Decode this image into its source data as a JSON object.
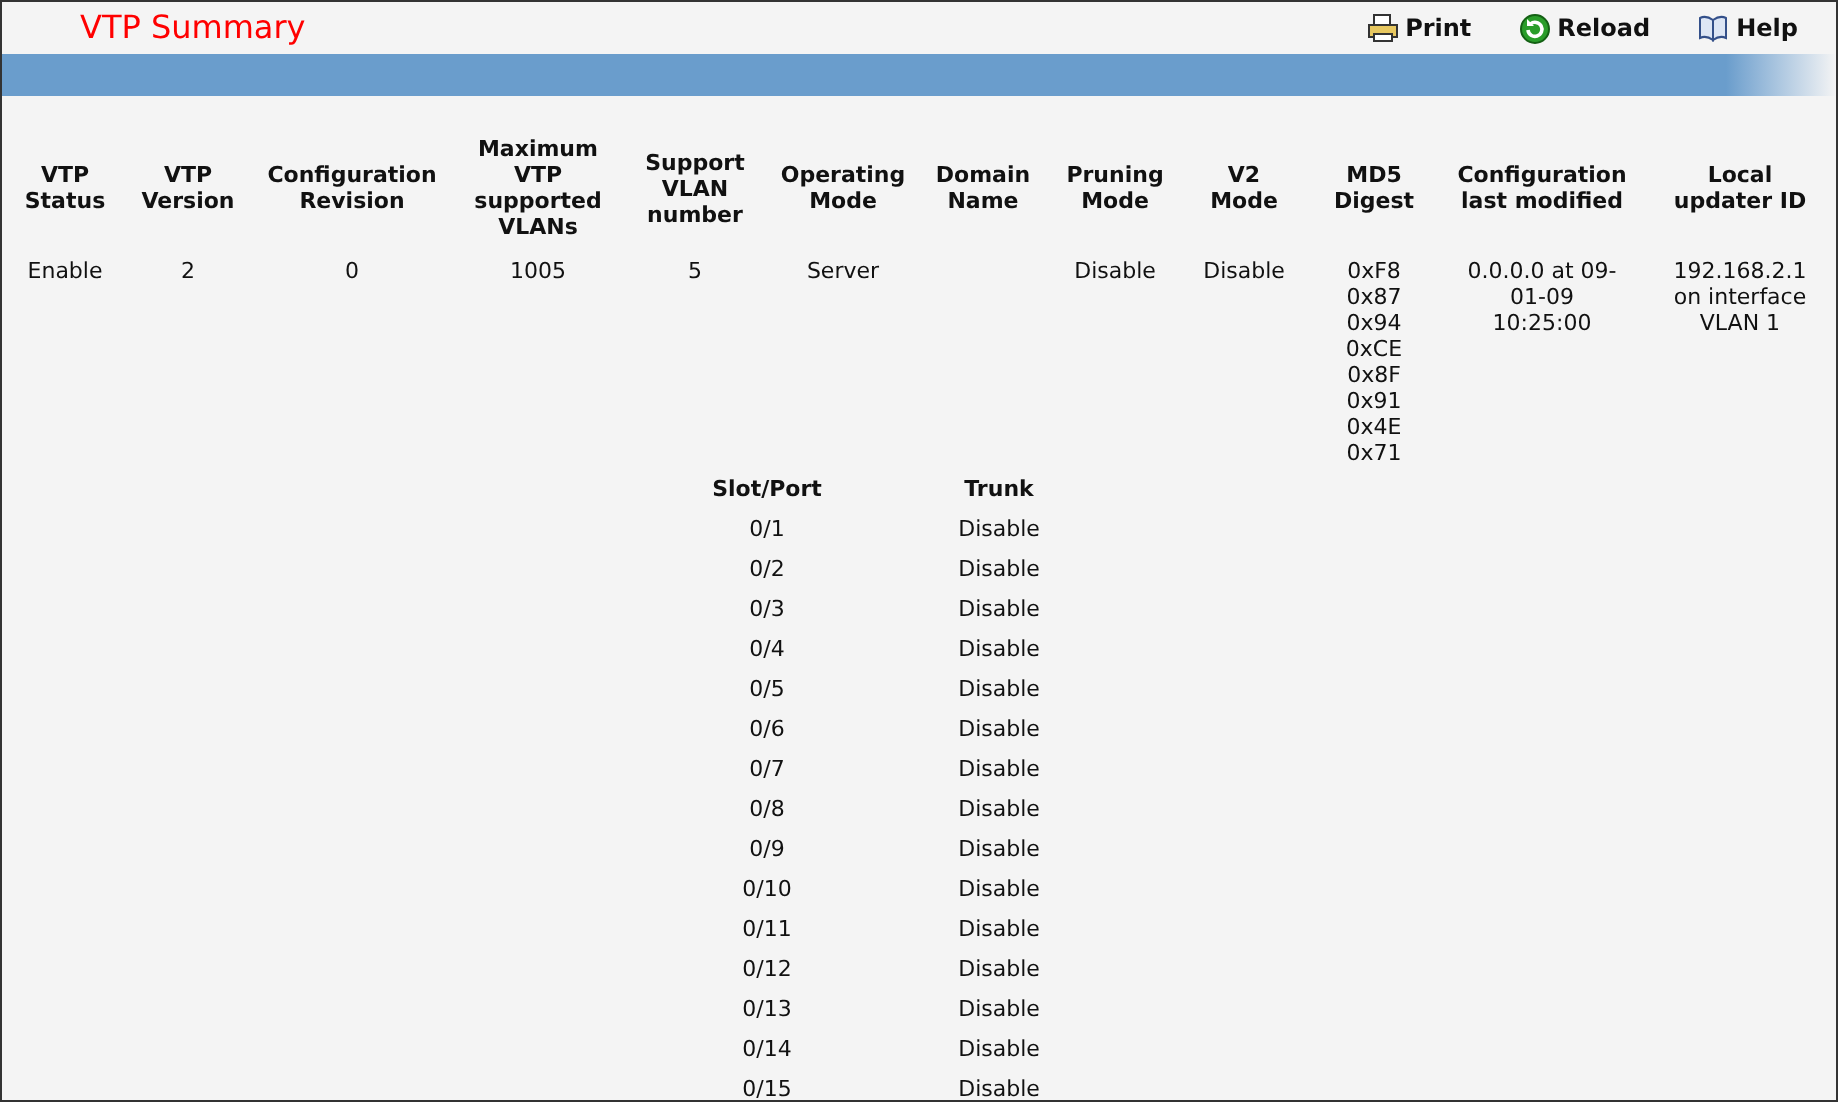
{
  "title": "VTP Summary",
  "toolbar": [
    {
      "kind": "print",
      "label": "Print"
    },
    {
      "kind": "reload",
      "label": "Reload"
    },
    {
      "kind": "help",
      "label": "Help"
    }
  ],
  "summary": {
    "columns": [
      {
        "label": "VTP\nStatus",
        "value": [
          "Enable"
        ]
      },
      {
        "label": "VTP\nVersion",
        "value": [
          "2"
        ]
      },
      {
        "label": "Configuration\nRevision",
        "value": [
          "0"
        ]
      },
      {
        "label": "Maximum\nVTP\nsupported\nVLANs",
        "value": [
          "1005"
        ]
      },
      {
        "label": "Support\nVLAN\nnumber",
        "value": [
          "5"
        ]
      },
      {
        "label": "Operating\nMode",
        "value": [
          "Server"
        ]
      },
      {
        "label": "Domain\nName"
      },
      {
        "label": "Pruning\nMode",
        "value": [
          "Disable"
        ]
      },
      {
        "label": "V2\nMode",
        "value": [
          "Disable"
        ]
      },
      {
        "label": "MD5\nDigest",
        "value": [
          "0xF8",
          "0x87",
          "0x94",
          "0xCE",
          "0x8F",
          "0x91",
          "0x4E",
          "0x71"
        ]
      },
      {
        "label": "Configuration\nlast modified",
        "value": [
          "0.0.0.0 at 09-\n01-09\n10:25:00"
        ]
      },
      {
        "label": "Local\nupdater ID",
        "value": [
          "192.168.2.1\non interface\nVLAN 1"
        ]
      }
    ]
  },
  "ports": {
    "columns": [
      "Slot/Port",
      "Trunk"
    ],
    "rows": [
      [
        "0/1",
        "Disable"
      ],
      [
        "0/2",
        "Disable"
      ],
      [
        "0/3",
        "Disable"
      ],
      [
        "0/4",
        "Disable"
      ],
      [
        "0/5",
        "Disable"
      ],
      [
        "0/6",
        "Disable"
      ],
      [
        "0/7",
        "Disable"
      ],
      [
        "0/8",
        "Disable"
      ],
      [
        "0/9",
        "Disable"
      ],
      [
        "0/10",
        "Disable"
      ],
      [
        "0/11",
        "Disable"
      ],
      [
        "0/12",
        "Disable"
      ],
      [
        "0/13",
        "Disable"
      ],
      [
        "0/14",
        "Disable"
      ],
      [
        "0/15",
        "Disable"
      ]
    ]
  }
}
